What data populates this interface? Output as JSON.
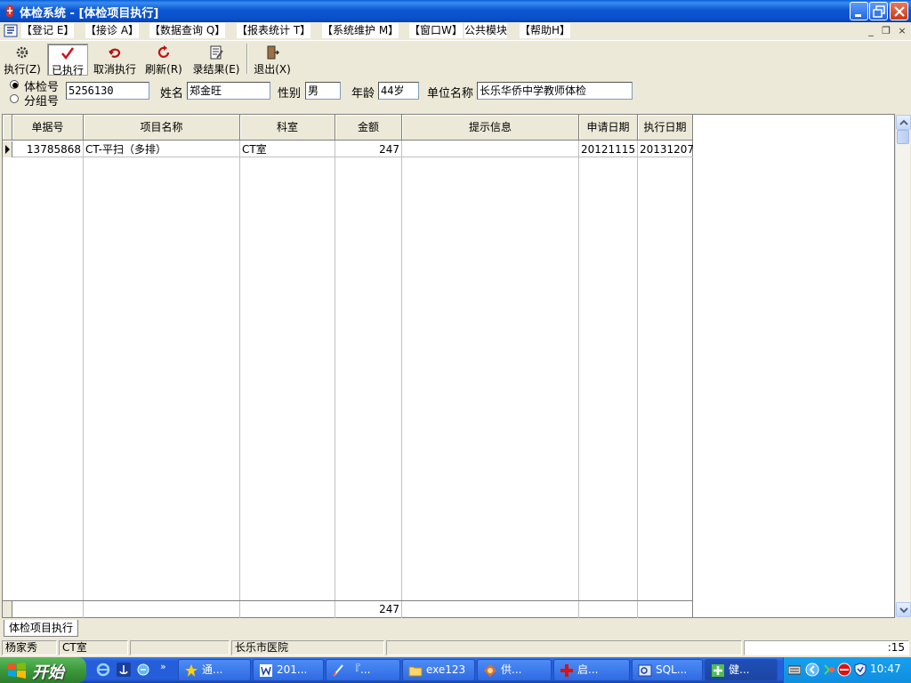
{
  "window": {
    "title": "体检系统 - [体检项目执行]"
  },
  "menu": {
    "items": [
      "【登记 E】",
      "【接诊 A】",
      "【数据查询 Q】",
      "【报表统计 T】",
      "【系统维护 M】",
      "【窗口W】",
      "公共模块",
      "【帮助H】"
    ]
  },
  "toolbar": {
    "execute": "执行(Z)",
    "executed": "已执行",
    "cancel_execute": "取消执行",
    "refresh": "刷新(R)",
    "record_result": "录结果(E)",
    "exit": "退出(X)"
  },
  "search": {
    "radio_exam_no": "体检号",
    "radio_group_no": "分组号",
    "exam_no_value": "5256130",
    "name_label": "姓名",
    "name_value": "郑金旺",
    "gender_label": "性别",
    "gender_value": "男",
    "age_label": "年龄",
    "age_value": "44岁",
    "unit_label": "单位名称",
    "unit_value": "长乐华侨中学教师体检"
  },
  "grid": {
    "columns": [
      "单据号",
      "项目名称",
      "科室",
      "金额",
      "提示信息",
      "申请日期",
      "执行日期"
    ],
    "rows": [
      {
        "doc_no": "13785868",
        "item": "CT-平扫（多排）",
        "dept": "CT室",
        "amount": "247",
        "tip": "",
        "apply_date": "20121115",
        "exec_date": "20131207"
      }
    ],
    "footer_amount": "247"
  },
  "tabs": {
    "active": "体检项目执行"
  },
  "status": {
    "user": "杨家秀",
    "dept": "CT室",
    "pane3": "",
    "hospital": "长乐市医院",
    "right_text": ":15"
  },
  "taskbar": {
    "start": "开始",
    "tasks": [
      "通...",
      "201...",
      "『...",
      "exe123",
      "供...",
      "启...",
      "SQL...",
      "健..."
    ],
    "clock": "10:47"
  }
}
